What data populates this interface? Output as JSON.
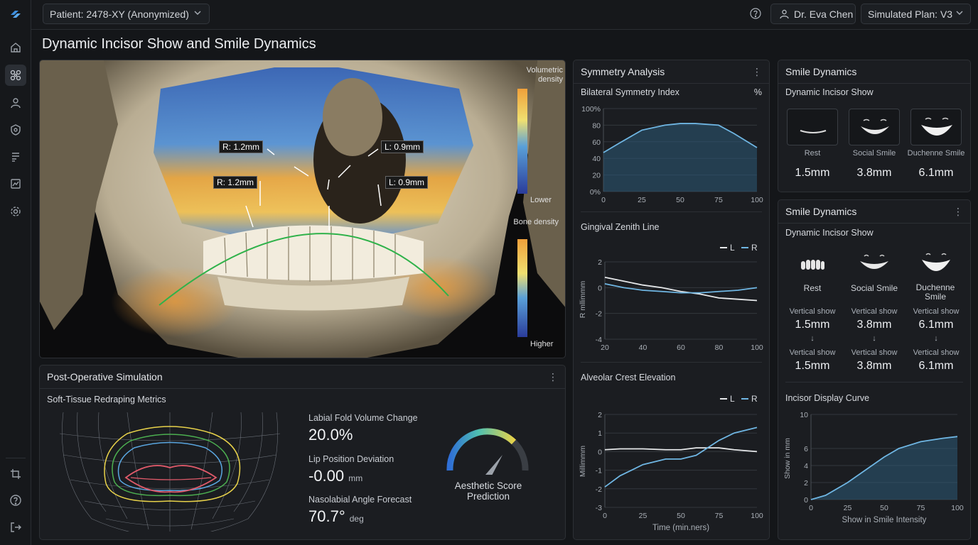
{
  "header": {
    "patient": "Patient: 2478-XY (Anonymized)",
    "user": "Dr. Eva Chen",
    "plan": "Simulated Plan: V3"
  },
  "page_title": "Dynamic Incisor Show and Smile Dynamics",
  "viewer": {
    "legend_vol_title": "Volumetric density",
    "legend_vol_low": "Lower",
    "legend_bone_title": "Bone density",
    "legend_bone_high": "Higher",
    "annotations": [
      "R: 1.2mm",
      "L: 0.9mm",
      "R: 1.2mm",
      "L: 0.9mm"
    ]
  },
  "postop": {
    "title": "Post-Operative Simulation",
    "subtitle": "Soft-Tissue Redraping Metrics",
    "m1_label": "Labial Fold Volume Change",
    "m1_value": "20.0%",
    "m2_label": "Lip Position Deviation",
    "m2_value": "-0.00",
    "m2_unit": "mm",
    "m3_label": "Nasolabial Angle Forecast",
    "m3_value": "70.7°",
    "m3_unit": "deg",
    "gauge_label": "Aesthetic Score Prediction"
  },
  "symmetry": {
    "title": "Symmetry Analysis",
    "chart1_title": "Bilateral Symmetry Index",
    "chart1_unit": "%",
    "chart2_title": "Gingival Zenith Line",
    "chart3_title": "Alveolar Crest Elevation",
    "legend_l": "L",
    "legend_r": "R",
    "chart2_ylabel": "R mllimmm",
    "chart3_ylabel": "Millimmm",
    "chart3_xlabel": "Time (min.ners)"
  },
  "smile_top": {
    "title": "Smile Dynamics",
    "subtitle": "Dynamic Incisor Show",
    "items": [
      {
        "label": "Rest",
        "value": "1.5mm"
      },
      {
        "label": "Social Smile",
        "value": "3.8mm"
      },
      {
        "label": "Duchenne Smile",
        "value": "6.1mm"
      }
    ]
  },
  "smile_bottom": {
    "title": "Smile Dynamics",
    "subtitle": "Dynamic Incisor Show",
    "items": [
      {
        "label": "Rest",
        "vs1": "Vertical show",
        "v1": "1.5mm",
        "vs2": "Vertical show",
        "v2": "1.5mm"
      },
      {
        "label": "Social Smile",
        "vs1": "Vertical show",
        "v1": "3.8mm",
        "vs2": "Vertical show",
        "v2": "3.8mm"
      },
      {
        "label": "Duchenne Smile",
        "vs1": "Vertical show",
        "v1": "6.1mm",
        "vs2": "Vertical show",
        "v2": "6.1mm"
      }
    ],
    "curve_title": "Incisor Display Curve",
    "curve_xlabel": "Show in Smile Intensity",
    "curve_ylabel": "Show in mm"
  },
  "colors": {
    "accent": "#6fb6e3",
    "green": "#2fb24a",
    "bg": "#141619"
  },
  "chart_data": [
    {
      "type": "area",
      "title": "Bilateral Symmetry Index",
      "x": [
        0,
        10,
        25,
        40,
        50,
        60,
        75,
        85,
        100
      ],
      "values": [
        47,
        58,
        74,
        80,
        82,
        82,
        80,
        70,
        53
      ],
      "ylim": [
        0,
        100
      ],
      "xlim": [
        0,
        100
      ],
      "yticks": [
        "0%",
        "20",
        "40",
        "60",
        "80",
        "100%"
      ],
      "xticks": [
        "0",
        "25",
        "50",
        "75",
        "100"
      ]
    },
    {
      "type": "line",
      "title": "Gingival Zenith Line",
      "x": [
        20,
        30,
        40,
        50,
        60,
        70,
        80,
        90,
        100
      ],
      "series": [
        {
          "name": "L",
          "values": [
            0.8,
            0.5,
            0.2,
            0,
            -0.3,
            -0.5,
            -0.8,
            -0.9,
            -1
          ]
        },
        {
          "name": "R",
          "values": [
            0.3,
            0,
            -0.2,
            -0.3,
            -0.4,
            -0.4,
            -0.3,
            -0.2,
            0
          ]
        }
      ],
      "ylim": [
        -4,
        2
      ],
      "xlim": [
        20,
        100
      ],
      "yticks": [
        "2",
        "0",
        "-2",
        "-4"
      ],
      "xticks": [
        "20",
        "40",
        "60",
        "80",
        "100"
      ]
    },
    {
      "type": "line",
      "title": "Alveolar Crest Elevation",
      "x": [
        0,
        10,
        25,
        40,
        50,
        60,
        75,
        85,
        100
      ],
      "series": [
        {
          "name": "L",
          "values": [
            0.1,
            0.15,
            0.15,
            0.1,
            0.1,
            0.2,
            0.2,
            0.1,
            0
          ]
        },
        {
          "name": "R",
          "values": [
            -1.9,
            -1.3,
            -0.7,
            -0.4,
            -0.4,
            -0.2,
            0.6,
            1,
            1.3
          ]
        }
      ],
      "ylim": [
        -3,
        2
      ],
      "xlim": [
        0,
        100
      ],
      "yticks": [
        "2",
        "1",
        "0",
        "-1",
        "-2",
        "-3"
      ],
      "xticks": [
        "0",
        "25",
        "50",
        "75",
        "100"
      ]
    },
    {
      "type": "area",
      "title": "Incisor Display Curve",
      "x": [
        0,
        10,
        25,
        40,
        50,
        60,
        75,
        90,
        100
      ],
      "values": [
        0,
        0.5,
        2,
        3.8,
        5,
        6,
        6.8,
        7.2,
        7.4
      ],
      "ylim": [
        0,
        10
      ],
      "xlim": [
        0,
        100
      ],
      "yticks": [
        "10",
        "6",
        "4",
        "2",
        "0"
      ],
      "xticks": [
        "0",
        "25",
        "50",
        "75",
        "100"
      ]
    }
  ]
}
